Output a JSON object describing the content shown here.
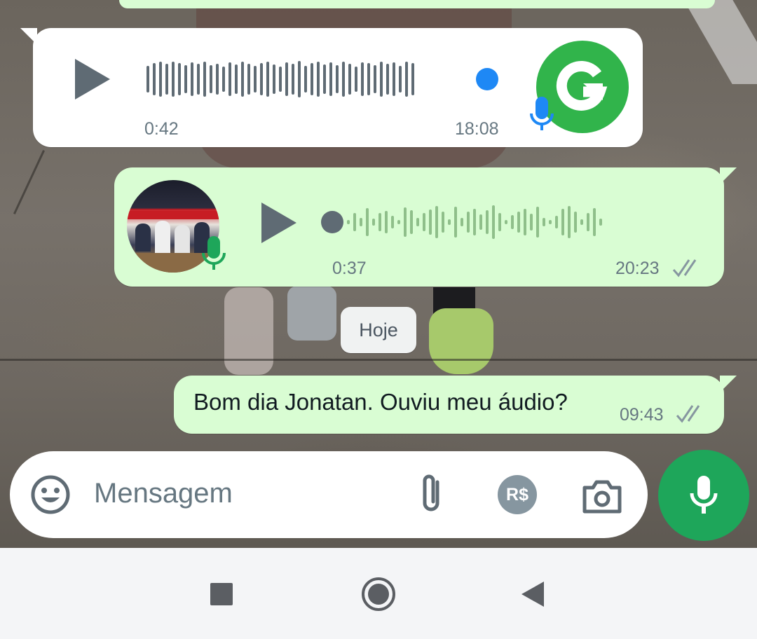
{
  "messages": {
    "received_audio": {
      "duration": "0:42",
      "timestamp": "18:08",
      "avatar_letter": "G",
      "avatar_color": "#31b44b"
    },
    "sent_audio": {
      "duration": "0:37",
      "timestamp": "20:23",
      "status": "delivered"
    },
    "date_separator": "Hoje",
    "sent_text": {
      "text": "Bom dia Jonatan. Ouviu meu áudio?",
      "timestamp": "09:43",
      "status": "delivered"
    }
  },
  "composer": {
    "placeholder": "Mensagem",
    "icons": [
      "emoji-icon",
      "paperclip-icon",
      "payment-icon",
      "camera-icon",
      "mic-icon"
    ],
    "payment_label": "R$"
  },
  "navbar": {
    "buttons": [
      "recents-button",
      "home-button",
      "back-button"
    ]
  },
  "colors": {
    "incoming_bubble": "#ffffff",
    "outgoing_bubble": "#d9fdd3",
    "accent_green": "#1ea65a",
    "played_dot": "#1e88f5"
  }
}
